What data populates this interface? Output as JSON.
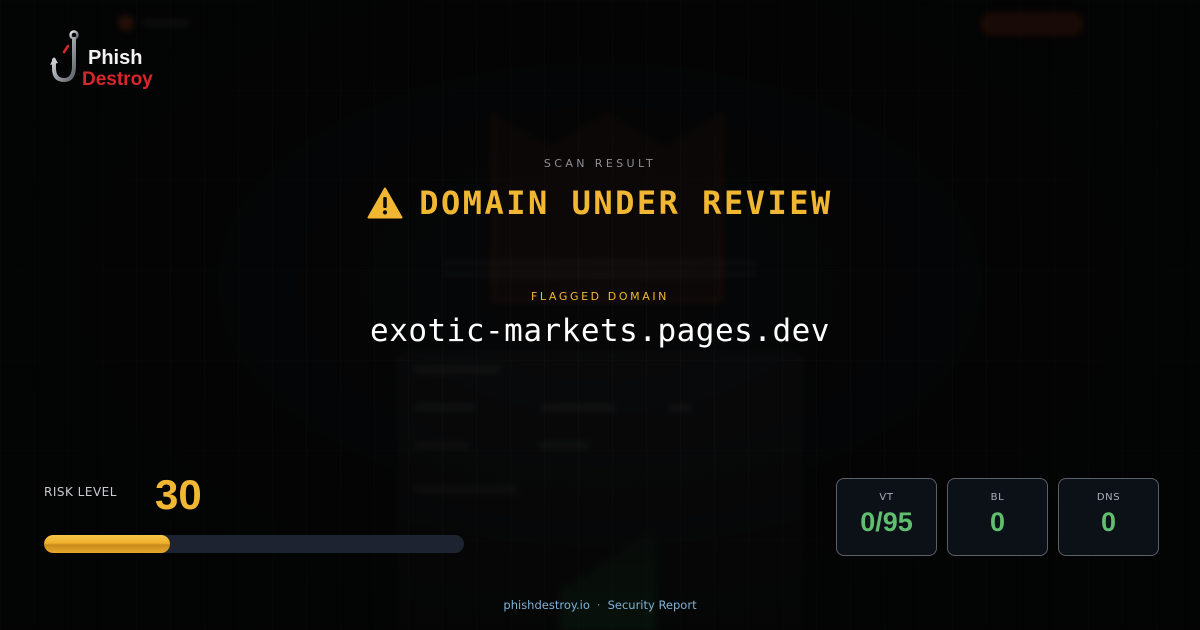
{
  "logo": {
    "line1": "Phish",
    "line2": "Destroy"
  },
  "header": {
    "section_label": "SCAN RESULT",
    "status_icon": "warning-triangle-icon",
    "status_text": "DOMAIN UNDER REVIEW",
    "flag_label": "FLAGGED DOMAIN",
    "domain": "exotic-markets.pages.dev"
  },
  "risk": {
    "label": "RISK LEVEL",
    "value": "30",
    "level_percent": 30
  },
  "stats": [
    {
      "label": "VT",
      "value": "0/95"
    },
    {
      "label": "BL",
      "value": "0"
    },
    {
      "label": "DNS",
      "value": "0"
    }
  ],
  "footer": {
    "site": "phishdestroy.io",
    "separator": "·",
    "report": "Security Report"
  },
  "colors": {
    "accent_warning": "#f2b732",
    "stat_ok": "#5fbf6e",
    "brand_red": "#d8262a",
    "footer_link": "#7fb1d6"
  }
}
